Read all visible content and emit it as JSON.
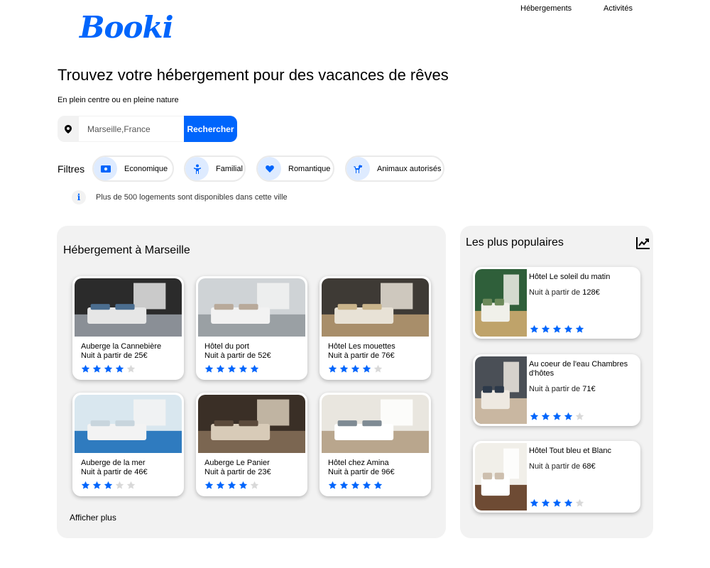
{
  "brand": {
    "logo": "Booki",
    "accent": "#0065FC"
  },
  "nav": {
    "items": [
      "Hébergements",
      "Activités"
    ]
  },
  "hero": {
    "title": "Trouvez votre hébergement pour des vacances de rêves",
    "subtitle": "En plein centre ou en pleine nature"
  },
  "search": {
    "value": "Marseille,France",
    "button": "Rechercher",
    "icon": "map-pin-icon"
  },
  "filters": {
    "label": "Filtres",
    "items": [
      {
        "label": "Economique",
        "icon": "money-icon"
      },
      {
        "label": "Familial",
        "icon": "child-icon"
      },
      {
        "label": "Romantique",
        "icon": "heart-icon"
      },
      {
        "label": "Animaux autorisés",
        "icon": "dog-icon"
      }
    ]
  },
  "info": {
    "text": "Plus de 500 logements sont disponibles dans cette ville",
    "icon": "info-icon"
  },
  "listings": {
    "title": "Hébergement à Marseille",
    "more": "Afficher plus",
    "price_prefix": "Nuit à partir de",
    "items": [
      {
        "name": "Auberge la Cannebière",
        "price": "25€",
        "rating": 4
      },
      {
        "name": "Hôtel du port",
        "price": "52€",
        "rating": 5
      },
      {
        "name": "Hôtel Les mouettes",
        "price": "76€",
        "rating": 4
      },
      {
        "name": "Auberge de la mer",
        "price": "46€",
        "rating": 3
      },
      {
        "name": "Auberge Le Panier",
        "price": "23€",
        "rating": 4
      },
      {
        "name": "Hôtel chez Amina",
        "price": "96€",
        "rating": 5
      }
    ]
  },
  "popular": {
    "title": "Les plus populaires",
    "icon": "trending-up-icon",
    "items": [
      {
        "name": "Hôtel Le soleil du matin",
        "price": "128€",
        "rating": 5
      },
      {
        "name": "Au coeur de l'eau Chambres d'hôtes",
        "price": "71€",
        "rating": 4
      },
      {
        "name": "Hôtel Tout bleu et Blanc",
        "price": "68€",
        "rating": 4
      }
    ]
  },
  "colors": {
    "star_on": "#0065FC",
    "star_off": "#D9D9D9",
    "panel": "#F2F2F2"
  }
}
